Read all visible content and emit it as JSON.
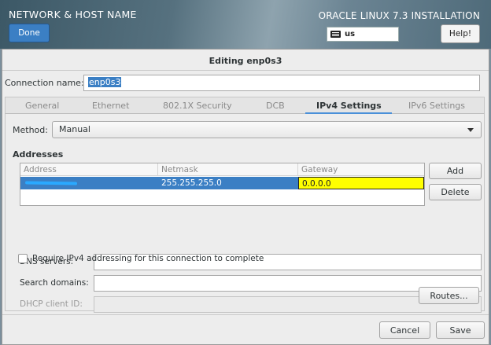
{
  "topbar": {
    "title": "NETWORK & HOST NAME",
    "done_label": "Done",
    "installer_title": "ORACLE LINUX 7.3 INSTALLATION",
    "keyboard_layout": "us",
    "help_label": "Help!"
  },
  "dialog": {
    "title": "Editing enp0s3",
    "connection_name_label": "Connection name:",
    "connection_name_value": "enp0s3",
    "tabs": [
      {
        "label": "General",
        "active": false
      },
      {
        "label": "Ethernet",
        "active": false
      },
      {
        "label": "802.1X Security",
        "active": false
      },
      {
        "label": "DCB",
        "active": false
      },
      {
        "label": "IPv4 Settings",
        "active": true
      },
      {
        "label": "IPv6 Settings",
        "active": false
      }
    ],
    "method_label": "Method:",
    "method_value": "Manual",
    "addresses_heading": "Addresses",
    "table": {
      "columns": [
        "Address",
        "Netmask",
        "Gateway"
      ],
      "rows": [
        {
          "address": "",
          "netmask": "255.255.255.0",
          "gateway": "0.0.0.0"
        }
      ]
    },
    "add_label": "Add",
    "delete_label": "Delete",
    "dns_label": "DNS servers:",
    "search_domains_label": "Search domains:",
    "dhcp_client_id_label": "DHCP client ID:",
    "require_ipv4_label": "Require IPv4 addressing for this connection to complete",
    "routes_label": "Routes...",
    "cancel_label": "Cancel",
    "save_label": "Save"
  },
  "colors": {
    "accent": "#3b7fc4",
    "gateway_highlight": "#ffff00",
    "redaction": "#2aa9ff"
  }
}
